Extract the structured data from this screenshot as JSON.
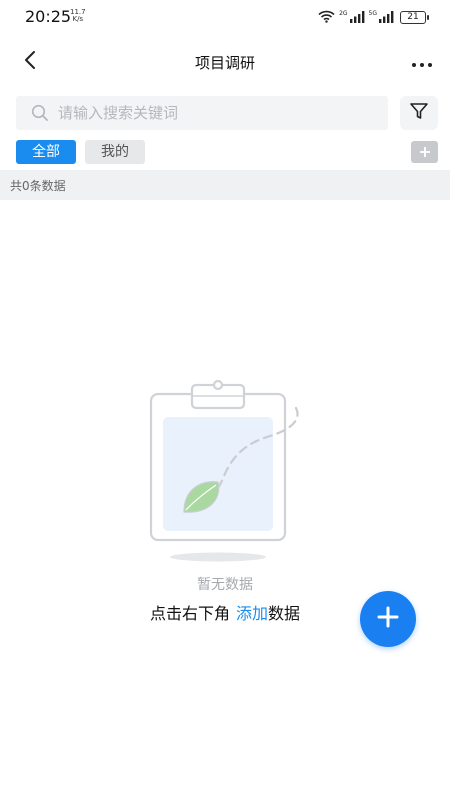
{
  "status_bar": {
    "time": "20:25",
    "speed_value": "11.7",
    "speed_unit": "K/s",
    "sim1_label": "2G",
    "sim2_label": "5G",
    "battery": "21"
  },
  "header": {
    "title": "项目调研",
    "back_icon": "chevron-left-icon",
    "more_icon": "more-horizontal-icon"
  },
  "search": {
    "placeholder": "请输入搜索关键词",
    "value": "",
    "filter_icon": "filter-icon"
  },
  "tabs": [
    {
      "label": "全部",
      "active": true
    },
    {
      "label": "我的",
      "active": false
    }
  ],
  "count_text": "共0条数据",
  "empty_state": {
    "title": "暂无数据",
    "hint_prefix": "点击右下角",
    "hint_link": "添加",
    "hint_suffix": "数据"
  },
  "colors": {
    "accent": "#1a8cf0",
    "fab": "#1a7ff0",
    "count_bar_bg": "#f0f1f3"
  }
}
